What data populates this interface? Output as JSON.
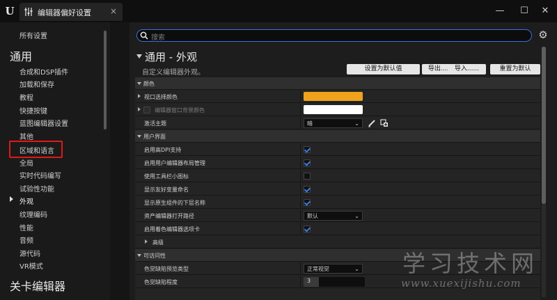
{
  "window": {
    "logo": "U",
    "tab_title": "编辑器偏好设置",
    "tab_close": "×",
    "minimize": "—",
    "maximize": "☐",
    "close": "✕"
  },
  "sidebar": {
    "all_settings": "所有设置",
    "category_general": "通用",
    "items": [
      {
        "label": "合成和DSP插件"
      },
      {
        "label": "加载和保存"
      },
      {
        "label": "教程"
      },
      {
        "label": "快捷按键"
      },
      {
        "label": "蓝图编辑器设置"
      },
      {
        "label": "其他"
      },
      {
        "label": "区域和语言"
      },
      {
        "label": "全局"
      },
      {
        "label": "实时代码编写"
      },
      {
        "label": "试验性功能"
      },
      {
        "label": "外观"
      },
      {
        "label": "纹理编码"
      },
      {
        "label": "性能"
      },
      {
        "label": "音频"
      },
      {
        "label": "源代码"
      },
      {
        "label": "VR模式"
      }
    ],
    "selected": "外观",
    "category_level": "关卡编辑器"
  },
  "search": {
    "placeholder": "搜索"
  },
  "header": {
    "title": "通用 - 外观",
    "subtitle": "自定义编辑器外观。",
    "buttons": [
      "设置为默认值",
      "导出......",
      "导入......",
      "重置为默认"
    ]
  },
  "sections": {
    "colors": {
      "title": "颜色",
      "viewport_selection": "视口选择颜色",
      "viewport_selection_color": "#f0a21d",
      "window_bg": "编辑器窗口背景颜色",
      "window_bg_color": "#ffffff",
      "active_theme": "激活主题",
      "active_theme_value": "暗"
    },
    "ui": {
      "title": "用户界面",
      "high_dpi": "启用高DPI支持",
      "window_layout": "启用用户编辑器布局管理",
      "small_icons": "使用工具栏小图标",
      "friendly_names": "显示友好变量命名",
      "native_names": "显示原生组件的下层名称",
      "asset_path": "资产编辑器打开路径",
      "asset_path_value": "默认",
      "colored_tabs": "启用着色编辑器选项卡",
      "advanced": "高级"
    },
    "access": {
      "title": "可访问性",
      "cb_preview": "色觉缺陷预览类型",
      "cb_preview_value": "正常视觉",
      "cb_severity": "色觉缺陷程度",
      "cb_severity_value": "3"
    }
  },
  "watermark": {
    "text": "学习技术网",
    "url": "www.xuexijishu.com"
  },
  "colors": {
    "accent": "#3c6ee0",
    "highlight_box": "#e01919",
    "viewport_selection": "#f0a21d"
  }
}
